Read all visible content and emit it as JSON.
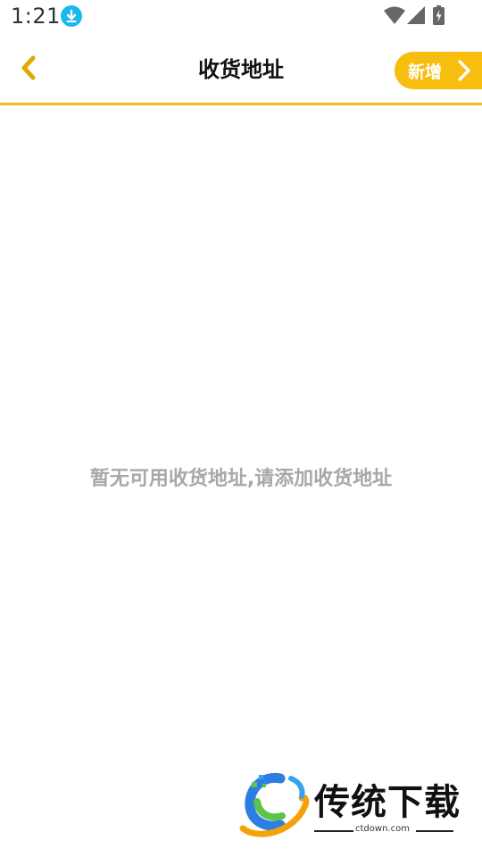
{
  "status_bar": {
    "time": "1:21",
    "icons": [
      "download-notification-icon",
      "wifi-icon",
      "cellular-signal-icon",
      "battery-charging-icon"
    ]
  },
  "header": {
    "title": "收货地址",
    "add_label": "新增",
    "back_icon": "chevron-left-icon",
    "add_icon": "chevron-right-icon"
  },
  "main": {
    "empty_message": "暂无可用收货地址,请添加收货地址"
  },
  "watermark": {
    "brand": "传统下载",
    "url": "ctdown.com"
  },
  "colors": {
    "accent": "#f7bd0f",
    "header_border": "#f2bd14",
    "back_icon": "#e0a800",
    "empty_text": "#a8a8a8",
    "download_badge": "#1ab8f0"
  }
}
